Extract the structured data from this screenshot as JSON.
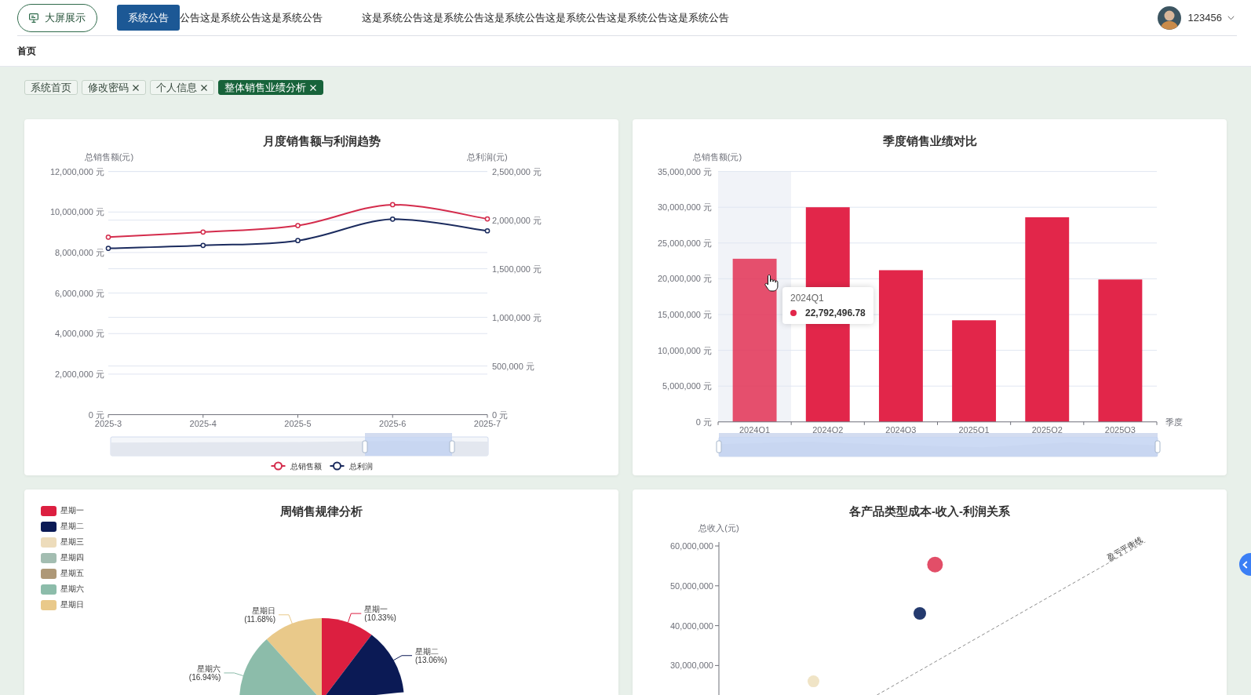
{
  "header": {
    "big_screen_button": "大屏展示",
    "notice_button": "系统公告",
    "notice_texts": [
      "公告这是系统公告这是系统公告",
      "这是系统公告这是系统公告这是系统公告这是系统公告这是系统公告这是系统公告"
    ],
    "user": {
      "name": "123456"
    }
  },
  "breadcrumb": [
    "首页"
  ],
  "tabs": [
    {
      "label": "系统首页",
      "closable": false,
      "selected": false
    },
    {
      "label": "修改密码",
      "closable": true,
      "selected": false
    },
    {
      "label": "个人信息",
      "closable": true,
      "selected": false
    },
    {
      "label": "整体销售业绩分析",
      "closable": true,
      "selected": true
    }
  ],
  "panels": [
    {
      "chart_data": {
        "type": "line",
        "title": "月度销售额与利润趋势",
        "categories": [
          "2025-3",
          "2025-4",
          "2025-5",
          "2025-6",
          "2025-7"
        ],
        "ylabel": "总销售额(元)",
        "ylim": [
          0,
          12000000
        ],
        "yticks": [
          {
            "value": 0,
            "label": "0 元"
          },
          {
            "value": 2000000,
            "label": "2,000,000 元"
          },
          {
            "value": 4000000,
            "label": "4,000,000 元"
          },
          {
            "value": 6000000,
            "label": "6,000,000 元"
          },
          {
            "value": 8000000,
            "label": "8,000,000 元"
          },
          {
            "value": 10000000,
            "label": "10,000,000 元"
          },
          {
            "value": 12000000,
            "label": "12,000,000 元"
          }
        ],
        "y2label": "总利润(元)",
        "y2lim": [
          0,
          2500000
        ],
        "y2ticks": [
          {
            "value": 0,
            "label": "0 元"
          },
          {
            "value": 500000,
            "label": "500,000 元"
          },
          {
            "value": 1000000,
            "label": "1,000,000 元"
          },
          {
            "value": 1500000,
            "label": "1,500,000 元"
          },
          {
            "value": 2000000,
            "label": "2,000,000 元"
          },
          {
            "value": 2500000,
            "label": "2,500,000 元"
          }
        ],
        "grid": true,
        "legend": "bottom",
        "series": [
          {
            "name": "总销售额",
            "color": "#d42c4c",
            "marker": "circle",
            "values": [
              8760000,
              9010000,
              9330000,
              10360000,
              9660000
            ]
          },
          {
            "name": "总利润",
            "color": "#1b2b5e",
            "marker": "circle",
            "axis": "y2",
            "values": [
              1710000,
              1740000,
              1790000,
              2010000,
              1890000
            ]
          }
        ]
      }
    },
    {
      "hovered": [
        true,
        false,
        false,
        false,
        false,
        false
      ],
      "tooltip": {
        "title": "2024Q1",
        "value": "22,792,496.78"
      },
      "chart_data": {
        "type": "bar",
        "title": "季度销售业绩对比",
        "xlabel": "季度",
        "ylabel": "总销售额(元)",
        "categories": [
          "2024Q1",
          "2024Q2",
          "2024Q3",
          "2025Q1",
          "2025Q2",
          "2025Q3"
        ],
        "ylim": [
          0,
          35000000
        ],
        "yticks": [
          {
            "value": 0,
            "label": "0 元"
          },
          {
            "value": 5000000,
            "label": "5,000,000 元"
          },
          {
            "value": 10000000,
            "label": "10,000,000 元"
          },
          {
            "value": 15000000,
            "label": "15,000,000 元"
          },
          {
            "value": 20000000,
            "label": "20,000,000 元"
          },
          {
            "value": 25000000,
            "label": "25,000,000 元"
          },
          {
            "value": 30000000,
            "label": "30,000,000 元"
          },
          {
            "value": 35000000,
            "label": "35,000,000 元"
          }
        ],
        "grid": true,
        "series": [
          {
            "color": "#e2264a",
            "values": [
              22800000,
              30000000,
              21200000,
              14200000,
              28600000,
              19900000
            ]
          }
        ]
      }
    },
    {
      "chart_data": {
        "type": "pie",
        "title": "周销售规律分析",
        "legend": "top-left",
        "categories": [
          "星期一",
          "星期二",
          "星期三",
          "星期四",
          "星期五",
          "星期六",
          "星期日"
        ],
        "values": [
          10.33,
          13.06,
          null,
          null,
          null,
          16.94,
          11.68
        ],
        "colors": [
          "#dc1f40",
          "#0b1a55",
          "#eddcbb",
          "#a3bdb1",
          "#ae9877",
          "#8cbcaa",
          "#e9c98a"
        ],
        "value_labels": [
          "(10.33%)",
          "(13.06%)",
          null,
          null,
          null,
          "(16.94%)",
          "(11.68%)"
        ]
      }
    },
    {
      "kind": "scatter",
      "title": "各产品类型成本-收入-利润关系",
      "y_axis": {
        "title": "总收入(元)",
        "ticks": [
          "60,000,000",
          "50,000,000",
          "40,000,000",
          "30,000,000"
        ]
      },
      "reference_line": {
        "label": "盈亏平衡线"
      }
    }
  ]
}
